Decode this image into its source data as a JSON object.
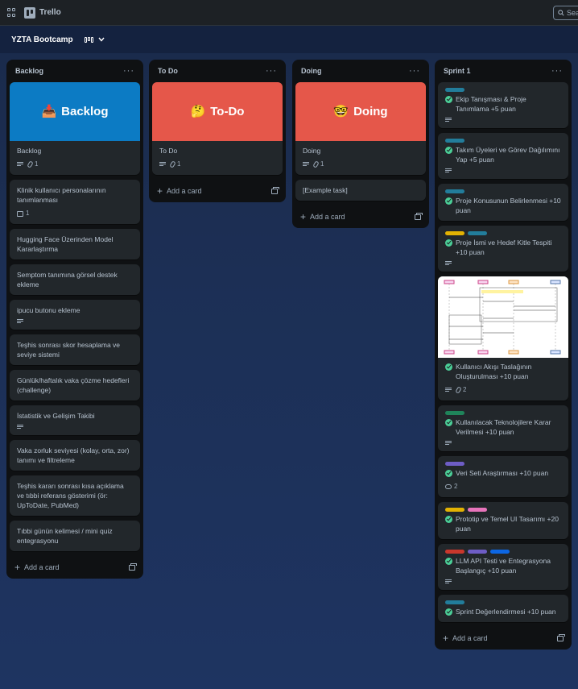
{
  "topbar": {
    "app_name": "Trello",
    "search_placeholder": "Sea"
  },
  "board": {
    "title": "YZTA Bootcamp"
  },
  "common": {
    "add_card": "Add a card",
    "more": "···"
  },
  "lists": {
    "backlog": {
      "title": "Backlog",
      "cover": {
        "emoji": "📥",
        "text": "Backlog",
        "color": "#0c7bc4"
      },
      "cover_card": {
        "title": "Backlog",
        "attachments": "1"
      },
      "cards": [
        {
          "title": "Klinik kullanıcı personalarının tanımlanması",
          "images": "1"
        },
        {
          "title": "Hugging Face Üzerinden Model Kararlaştırma"
        },
        {
          "title": "Semptom tanımına görsel destek ekleme"
        },
        {
          "title": "ipucu butonu ekleme"
        },
        {
          "title": "Teşhis sonrası skor hesaplama ve seviye sistemi"
        },
        {
          "title": "Günlük/haftalık vaka çözme hedefleri (challenge)"
        },
        {
          "title": "İstatistik ve Gelişim Takibi"
        },
        {
          "title": "Vaka zorluk seviyesi (kolay, orta, zor) tanımı ve filtreleme"
        },
        {
          "title": "Teşhis kararı sonrası kısa açıklama ve tıbbi referans gösterimi (ör: UpToDate, PubMed)"
        },
        {
          "title": "Tıbbi günün kelimesi / mini quiz entegrasyonu"
        }
      ]
    },
    "todo": {
      "title": "To Do",
      "cover": {
        "emoji": "🤔",
        "text": "To-Do",
        "color": "#e5574a"
      },
      "cover_card": {
        "title": "To Do",
        "attachments": "1"
      }
    },
    "doing": {
      "title": "Doing",
      "cover": {
        "emoji": "🤓",
        "text": "Doing",
        "color": "#e5574a"
      },
      "cover_card": {
        "title": "Doing",
        "attachments": "1"
      },
      "cards": [
        {
          "title": "[Example task]"
        }
      ]
    },
    "sprint1": {
      "title": "Sprint 1",
      "cards": [
        {
          "title": "Ekip Tanışması & Proje Tanımlama +5 puan",
          "labels": [
            "#227d9b"
          ]
        },
        {
          "title": "Takım Üyeleri ve Görev Dağılımını Yap +5 puan",
          "labels": [
            "#227d9b"
          ]
        },
        {
          "title": "Proje Konusunun Belirlenmesi +10 puan",
          "labels": [
            "#227d9b"
          ]
        },
        {
          "title": "Proje İsmi ve Hedef Kitle Tespiti +10 puan",
          "labels": [
            "#e2b203",
            "#227d9b"
          ]
        },
        {
          "title": "Kullanıcı Akışı Taslağının Oluşturulması +10 puan",
          "attachments": "2"
        },
        {
          "title": "Kullanılacak Teknolojilere Karar Verilmesi +10 puan",
          "labels": [
            "#1f845a"
          ]
        },
        {
          "title": "Veri Seti Araştırması +10 puan",
          "labels": [
            "#6e5dc6"
          ],
          "comments": "2"
        },
        {
          "title": "Prototip ve Temel UI Tasarımı +20 puan",
          "labels": [
            "#e2b203",
            "#e774bb"
          ]
        },
        {
          "title": "LLM API Testi ve Entegrasyona Başlangıç +10 puan",
          "labels": [
            "#c9372c",
            "#6e5dc6",
            "#0c66e4"
          ]
        },
        {
          "title": "Sprint Değerlendirmesi +10 puan",
          "labels": [
            "#227d9b"
          ]
        }
      ]
    }
  }
}
